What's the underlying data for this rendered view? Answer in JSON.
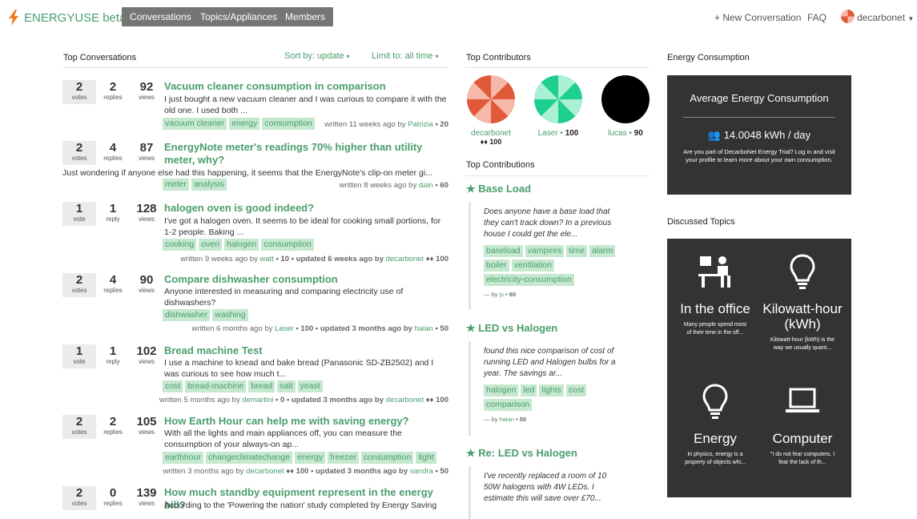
{
  "brand": {
    "name": "ENERGYUSE",
    "beta": "beta",
    "color": "#4a9e6d"
  },
  "nav": {
    "conversations": "Conversations",
    "topics": "Topics/Appliances",
    "members": "Members"
  },
  "header_right": {
    "new_conversation": "+ New Conversation",
    "faq": "FAQ",
    "user": "decarbonet"
  },
  "top_conversations": {
    "heading": "Top Conversations",
    "sort": "Sort by: update",
    "limit": "Limit to: all time",
    "items": [
      {
        "votes": "2",
        "votes_lbl": "votes",
        "replies": "2",
        "replies_lbl": "replies",
        "views": "92",
        "views_lbl": "views",
        "title": "Vacuum cleaner consumption in comparison",
        "excerpt": "I just bought a new vacuum cleaner and I was curious to compare it with the old one. I used both ...",
        "tags": [
          "vacuum cleaner",
          "energy",
          "consumption"
        ],
        "meta_pre": "written 11 weeks ago by ",
        "user": "Patrizia",
        "meta_post": " • 20"
      },
      {
        "votes": "2",
        "votes_lbl": "votes",
        "replies": "4",
        "replies_lbl": "replies",
        "views": "87",
        "views_lbl": "views",
        "title": "EnergyNote meter's readings 70% higher than utility meter, why?",
        "excerpt": "Just wondering if anyone else had this happening, it seems that the EnergyNote's clip-on meter gi...",
        "tags": [
          "meter",
          "analysis"
        ],
        "meta_pre": "written 8 weeks ago by ",
        "user": "dain",
        "meta_post": " • 60"
      },
      {
        "votes": "1",
        "votes_lbl": "vote",
        "replies": "1",
        "replies_lbl": "reply",
        "views": "128",
        "views_lbl": "views",
        "title": "halogen oven is good indeed?",
        "excerpt": "I've got a halogen oven. It seems to be ideal for cooking small portions, for 1-2 people. Baking ...",
        "tags": [
          "cooking",
          "oven",
          "halogen",
          "consumption"
        ],
        "meta_pre": "written 9 weeks ago by ",
        "user": "watt",
        "meta_post": " • 10 • updated 6 weeks ago by ",
        "user2": "decarbonet",
        "meta_post2": " ♦♦ 100"
      },
      {
        "votes": "2",
        "votes_lbl": "votes",
        "replies": "4",
        "replies_lbl": "replies",
        "views": "90",
        "views_lbl": "views",
        "title": "Compare dishwasher consumption",
        "excerpt": "Anyone interested in measuring and comparing electricity use of dishwashers?",
        "tags": [
          "dishwasher",
          "washing"
        ],
        "meta_pre": "written 6 months ago by ",
        "user": "Laser",
        "meta_post": " • 100 • updated 3 months ago by ",
        "user2": "halan",
        "meta_post2": " • 50"
      },
      {
        "votes": "1",
        "votes_lbl": "vote",
        "replies": "1",
        "replies_lbl": "reply",
        "views": "102",
        "views_lbl": "views",
        "title": "Bread machine Test",
        "excerpt": "I use a machine to knead and bake bread (Panasonic SD-ZB2502) and I was curious to see how much t...",
        "tags": [
          "cost",
          "bread-machine",
          "bread",
          "salt",
          "yeast"
        ],
        "meta_pre": "written 5 months ago by ",
        "user": "demartini",
        "meta_post": " • 0 • updated 3 months ago by ",
        "user2": "decarbonet",
        "meta_post2": " ♦♦ 100"
      },
      {
        "votes": "2",
        "votes_lbl": "votes",
        "replies": "2",
        "replies_lbl": "replies",
        "views": "105",
        "views_lbl": "views",
        "title": "How Earth Hour can help me with saving energy?",
        "excerpt": "With all the lights and main appliances off, you can measure the consumption of your always-on ap...",
        "tags": [
          "earthhour",
          "changeclimatechange",
          "energy",
          "freezer",
          "consumption",
          "light"
        ],
        "meta_pre": "written 3 months ago by ",
        "user": "decarbonet",
        "meta_post": " ♦♦ 100 • updated 3 months ago by ",
        "user2": "sandra",
        "meta_post2": " • 50"
      },
      {
        "votes": "2",
        "votes_lbl": "votes",
        "replies": "0",
        "replies_lbl": "replies",
        "views": "139",
        "views_lbl": "views",
        "title": "How much standby equipment represent in the energy bill?",
        "excerpt": "According to the 'Powering the nation' study completed by Energy Saving"
      }
    ]
  },
  "top_contributors": {
    "heading": "Top Contributors",
    "items": [
      {
        "name": "decarbonet",
        "score": "♦♦ 100"
      },
      {
        "name": "Laser",
        "score": "100"
      },
      {
        "name": "lucas",
        "score": "90"
      }
    ]
  },
  "top_contributions": {
    "heading": "Top Contributions",
    "items": [
      {
        "title": "Base Load",
        "text": "Does anyone have a base load that they can't track down? In a previous house I could get the ele...",
        "tags": [
          "baseload",
          "vampires",
          "time",
          "alarm",
          "boiler",
          "ventilation",
          "electricity-consumption"
        ],
        "by": "— by ",
        "user": "js",
        "score": " • 60"
      },
      {
        "title": "LED vs Halogen",
        "text": "found this nice comparison of cost of running LED and Halogen bulbs for a year. The savings ar...",
        "tags": [
          "halogen",
          "led",
          "lights",
          "cost",
          "comparison"
        ],
        "by": "— by ",
        "user": "halan",
        "score": " • 50"
      },
      {
        "title": "Re: LED vs Halogen",
        "text": "I've recently replaced a room of 10 50W halogens with 4W LEDs. I estimate this will save over £70..."
      }
    ]
  },
  "energy_consumption": {
    "heading": "Energy Consumption",
    "box_title": "Average Energy Consumption",
    "value": "14.0048 kWh / day",
    "note": "Are you part of DecarboNet Energy Trial? Log in and visit your profile to learn more about your own consumption."
  },
  "discussed_topics": {
    "heading": "Discussed Topics",
    "items": [
      {
        "title": "In the office",
        "desc": "Many people spend most of their time in the off..."
      },
      {
        "title": "Kilowatt-hour (kWh)",
        "desc": "Kilowatt-hour (kWh) is the way we usually quant..."
      },
      {
        "title": "Energy",
        "desc": "In physics, energy is a property of objects whi..."
      },
      {
        "title": "Computer",
        "desc": "\"I do not fear computers. I fear the lack of th..."
      }
    ]
  }
}
